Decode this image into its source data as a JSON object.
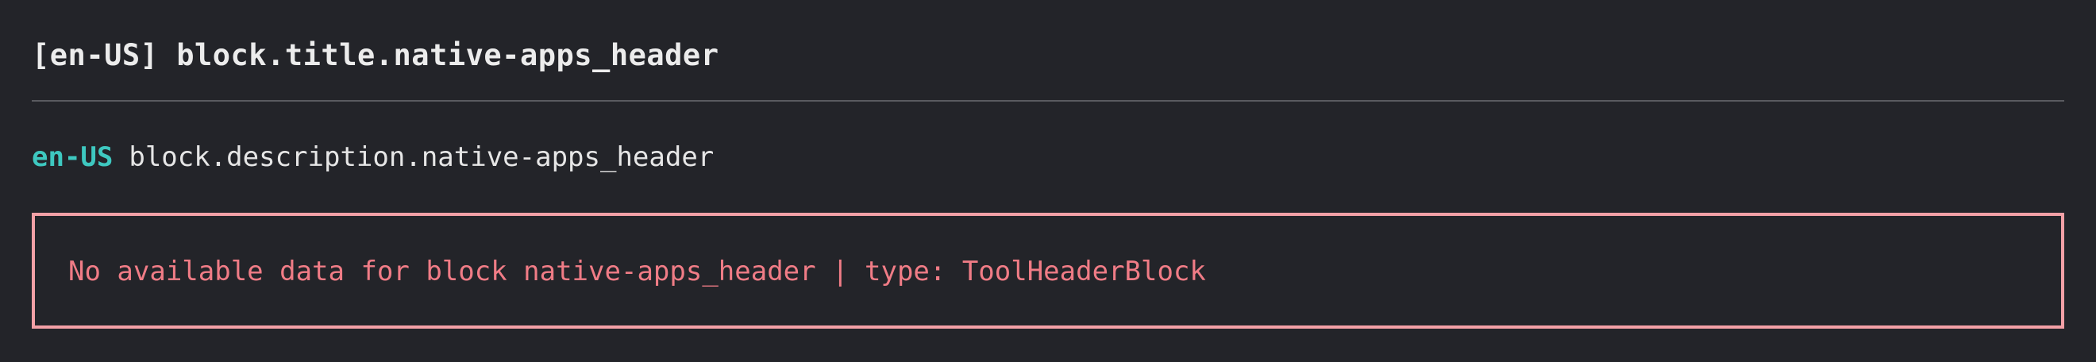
{
  "block": {
    "title": "[en-US] block.title.native-apps_header",
    "locale": "en-US",
    "description": "block.description.native-apps_header",
    "error_message": "No available data for block native-apps_header | type: ToolHeaderBlock"
  },
  "colors": {
    "background": "#232429",
    "locale_accent": "#3ec8c0",
    "error_border": "#f3a0a6",
    "error_text": "#f07c86",
    "divider": "#5a5b60"
  }
}
